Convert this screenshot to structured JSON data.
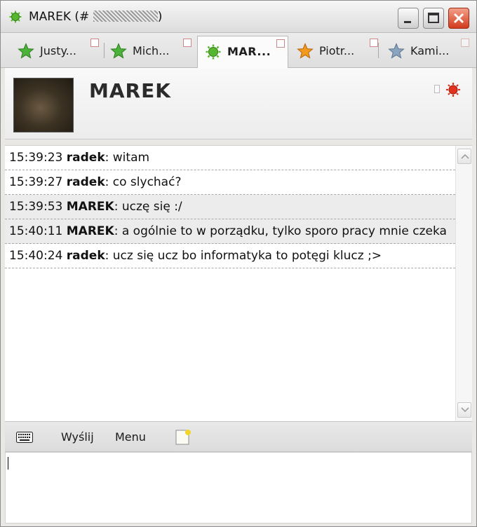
{
  "window": {
    "title_prefix": "MAREK (#",
    "title_suffix": ")"
  },
  "tabs": [
    {
      "label": "Justy...",
      "star": "green-star-icon",
      "color": "#4bb33a"
    },
    {
      "label": "Mich...",
      "star": "green-star-icon",
      "color": "#4bb33a"
    },
    {
      "label": "MAR...",
      "star": "green-gear-icon",
      "color": "#4bb33a",
      "active": true
    },
    {
      "label": "Piotr...",
      "star": "orange-star-icon",
      "color": "#f29a1e"
    },
    {
      "label": "Kami...",
      "star": "gray-star-icon",
      "color": "#8aa3bf"
    }
  ],
  "contact": {
    "name": "MAREK",
    "status_color": "#e0321e"
  },
  "messages": [
    {
      "time": "15:39:23",
      "nick": "radek",
      "text": ": witam"
    },
    {
      "time": "15:39:27",
      "nick": "radek",
      "text": ": co slychać?"
    },
    {
      "time": "15:39:53",
      "nick": "MAREK",
      "text": ": uczę się :/"
    },
    {
      "time": "15:40:11",
      "nick": "MAREK",
      "text": ": a ogólnie to w porządku, tylko sporo pracy mnie czeka"
    },
    {
      "time": "15:40:24",
      "nick": "radek",
      "text": ": ucz się ucz bo informatyka to potęgi klucz ;>"
    }
  ],
  "toolbar": {
    "send_label": "Wyślij",
    "menu_label": "Menu"
  },
  "input": {
    "value": ""
  }
}
